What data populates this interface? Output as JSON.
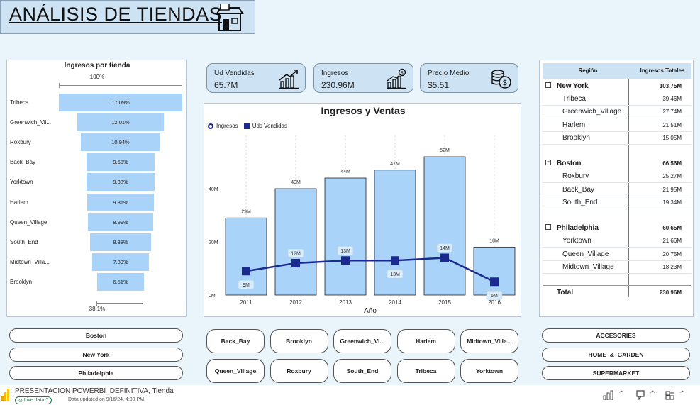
{
  "header": {
    "title": "ANÁLISIS DE TIENDAS"
  },
  "funnel": {
    "title": "Ingresos por tienda",
    "top_label": "100%",
    "bottom_label": "38.1%",
    "items": [
      {
        "label": "Tribeca",
        "pct": "17.09%",
        "value": 17.09
      },
      {
        "label": "Greenwich_Vil...",
        "pct": "12.01%",
        "value": 12.01
      },
      {
        "label": "Roxbury",
        "pct": "10.94%",
        "value": 10.94
      },
      {
        "label": "Back_Bay",
        "pct": "9.50%",
        "value": 9.5
      },
      {
        "label": "Yorktown",
        "pct": "9.38%",
        "value": 9.38
      },
      {
        "label": "Harlem",
        "pct": "9.31%",
        "value": 9.31
      },
      {
        "label": "Queen_Village",
        "pct": "8.99%",
        "value": 8.99
      },
      {
        "label": "South_End",
        "pct": "8.38%",
        "value": 8.38
      },
      {
        "label": "Midtown_Villa...",
        "pct": "7.89%",
        "value": 7.89
      },
      {
        "label": "Brooklyn",
        "pct": "6.51%",
        "value": 6.51
      }
    ]
  },
  "kpis": [
    {
      "label": "Ud Vendidas",
      "value": "65.7M",
      "icon": "growth-chart-icon"
    },
    {
      "label": "Ingresos",
      "value": "230.96M",
      "icon": "revenue-chart-icon"
    },
    {
      "label": "Precio Medio",
      "value": "$5.51",
      "icon": "coins-icon"
    }
  ],
  "chart_data": {
    "type": "bar",
    "title": "Ingresos y Ventas",
    "xlabel": "Año",
    "ylabel": "",
    "categories": [
      "2011",
      "2012",
      "2013",
      "2014",
      "2015",
      "2016"
    ],
    "ylim": [
      0,
      60
    ],
    "yticks": [
      "0M",
      "20M",
      "40M"
    ],
    "series": [
      {
        "name": "Ingresos",
        "kind": "bar",
        "values": [
          29,
          40,
          44,
          47,
          52,
          18
        ],
        "labels": [
          "29M",
          "40M",
          "44M",
          "47M",
          "52M",
          "18M"
        ]
      },
      {
        "name": "Uds Vendidas",
        "kind": "line",
        "values": [
          9,
          12,
          13,
          13,
          14,
          5
        ],
        "labels": [
          "9M",
          "12M",
          "13M",
          "13M",
          "14M",
          "5M"
        ]
      }
    ],
    "colors": {
      "bar": "#a9d3f9",
      "line": "#1b2a8f"
    }
  },
  "matrix": {
    "col1": "Región",
    "col2": "Ingresos Totales",
    "groups": [
      {
        "name": "New York",
        "total": "103.75M",
        "children": [
          {
            "name": "Tribeca",
            "value": "39.46M"
          },
          {
            "name": "Greenwich_Village",
            "value": "27.74M"
          },
          {
            "name": "Harlem",
            "value": "21.51M"
          },
          {
            "name": "Brooklyn",
            "value": "15.05M"
          }
        ]
      },
      {
        "name": "Boston",
        "total": "66.56M",
        "children": [
          {
            "name": "Roxbury",
            "value": "25.27M"
          },
          {
            "name": "Back_Bay",
            "value": "21.95M"
          },
          {
            "name": "South_End",
            "value": "19.34M"
          }
        ]
      },
      {
        "name": "Philadelphia",
        "total": "60.65M",
        "children": [
          {
            "name": "Yorktown",
            "value": "21.66M"
          },
          {
            "name": "Queen_Village",
            "value": "20.75M"
          },
          {
            "name": "Midtown_Village",
            "value": "18.23M"
          }
        ]
      }
    ],
    "total_label": "Total",
    "total_value": "230.96M"
  },
  "slicers": {
    "cities": [
      "Boston",
      "New York",
      "Philadelphia"
    ],
    "stores": [
      "Back_Bay",
      "Brooklyn",
      "Greenwich_Vi...",
      "Harlem",
      "Midtown_Villa...",
      "Queen_Village",
      "Roxbury",
      "South_End",
      "Tribeca",
      "Yorktown"
    ],
    "categories": [
      "ACCESORIES",
      "HOME_&_GARDEN",
      "SUPERMARKET"
    ]
  },
  "statusbar": {
    "file_title": "PRESENTACION POWERBI_DEFINITIVA, Tienda",
    "live": "Live data",
    "updated": "Data updated on 9/16/24, 4:30 PM"
  }
}
